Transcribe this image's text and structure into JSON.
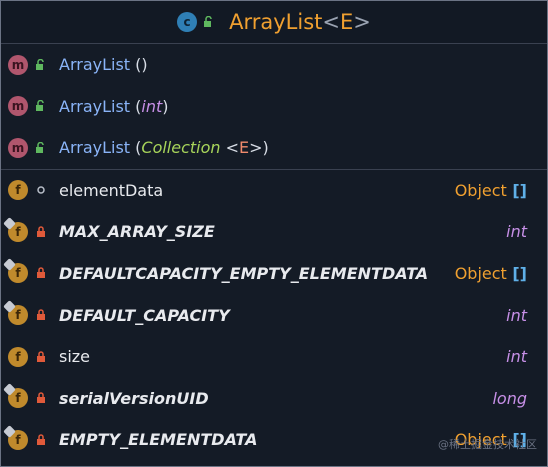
{
  "title": {
    "class_name": "ArrayList",
    "lt": "<",
    "type_param": "E",
    "gt": ">",
    "badge": "c"
  },
  "constructors": [
    {
      "name": "ArrayList",
      "open": " (",
      "arg": "",
      "lt": "",
      "tp": "",
      "gt": "",
      "close": ")"
    },
    {
      "name": "ArrayList",
      "open": " (",
      "arg": "int",
      "lt": "",
      "tp": "",
      "gt": "",
      "close": ")"
    },
    {
      "name": "ArrayList",
      "open": " (",
      "arg": "Collection ",
      "lt": "<",
      "tp": "E",
      "gt": ">",
      "close": ")"
    }
  ],
  "fields": [
    {
      "name": "elementData",
      "type": "Object",
      "brackets": " []"
    },
    {
      "name": "MAX_ARRAY_SIZE",
      "type": "int",
      "brackets": ""
    },
    {
      "name": "DEFAULTCAPACITY_EMPTY_ELEMENTDATA",
      "type": "Object",
      "brackets": " []"
    },
    {
      "name": "DEFAULT_CAPACITY",
      "type": "int",
      "brackets": ""
    },
    {
      "name": "size",
      "type": "int",
      "brackets": ""
    },
    {
      "name": "serialVersionUID",
      "type": "long",
      "brackets": ""
    },
    {
      "name": "EMPTY_ELEMENTDATA",
      "type": "Object",
      "brackets": " []"
    }
  ],
  "icons": {
    "method": "m",
    "field": "f"
  },
  "watermark": "@稀土掘金技术社区",
  "colors": {
    "background": "#141b26",
    "class_name": "#f0a030",
    "constructor": "#8ab4f8",
    "primitive": "#c68fe6",
    "generic_arg": "#a7d45a"
  }
}
